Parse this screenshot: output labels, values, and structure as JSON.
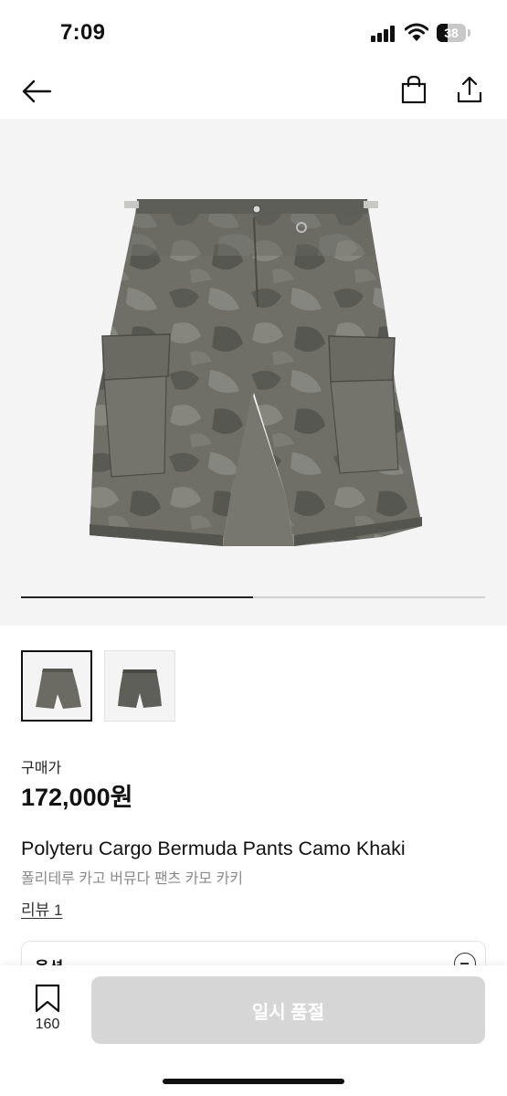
{
  "status_bar": {
    "time": "7:09",
    "battery_level": "38",
    "battery_fraction": 0.38
  },
  "nav": {
    "back_icon": "arrow-left-icon",
    "bag_icon": "shopping-bag-icon",
    "share_icon": "share-upload-icon"
  },
  "gallery": {
    "image": "camo-cargo-shorts-image",
    "slide_index": 1,
    "slide_count": 2,
    "progress_fraction": 0.5
  },
  "product": {
    "price_label": "구매가",
    "price": "172,000원",
    "name_en": "Polyteru Cargo Bermuda Pants Camo Khaki",
    "name_ko": "폴리테루 카고 버뮤다 팬츠 카모 카키",
    "review_link": "리뷰 1"
  },
  "option": {
    "label": "옵션"
  },
  "bottom": {
    "bookmark_count": "160",
    "cta_label": "일시 품절"
  },
  "colors": {
    "accent": "#111111",
    "disabled_button": "#d6d6d6",
    "image_background": "#f4f4f4"
  }
}
